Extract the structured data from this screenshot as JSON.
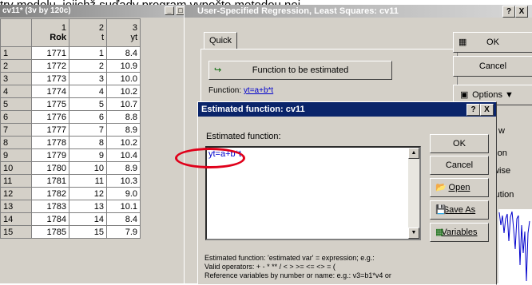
{
  "caption": "try modelu, jejichž suďady program vypočte metodou nej",
  "spreadsheet": {
    "title": "cv11* (3v by 120c)",
    "columns": [
      {
        "number": "1",
        "name": "Rok"
      },
      {
        "number": "2",
        "name": "t"
      },
      {
        "number": "3",
        "name": "yt"
      }
    ],
    "rows": [
      [
        "1",
        "1771",
        "1",
        "8.4"
      ],
      [
        "2",
        "1772",
        "2",
        "10.9"
      ],
      [
        "3",
        "1773",
        "3",
        "10.0"
      ],
      [
        "4",
        "1774",
        "4",
        "10.2"
      ],
      [
        "5",
        "1775",
        "5",
        "10.7"
      ],
      [
        "6",
        "1776",
        "6",
        "8.8"
      ],
      [
        "7",
        "1777",
        "7",
        "8.9"
      ],
      [
        "8",
        "1778",
        "8",
        "10.2"
      ],
      [
        "9",
        "1779",
        "9",
        "10.4"
      ],
      [
        "10",
        "1780",
        "10",
        "8.9"
      ],
      [
        "11",
        "1781",
        "11",
        "10.3"
      ],
      [
        "12",
        "1782",
        "12",
        "9.0"
      ],
      [
        "13",
        "1783",
        "13",
        "10.1"
      ],
      [
        "14",
        "1784",
        "14",
        "8.4"
      ],
      [
        "15",
        "1785",
        "15",
        "7.9"
      ]
    ]
  },
  "regression_dialog": {
    "title": "User-Specified Regression, Least Squares: cv11",
    "help": "?",
    "close": "X",
    "tab_quick": "Quick",
    "function_button": "Function to be estimated",
    "function_label": "Function:",
    "function_value": "yt=a+b*t",
    "ok": "OK",
    "cancel": "Cancel",
    "options": "Options",
    "partial": [
      "w",
      "ation",
      "ewise",
      "n",
      "titution"
    ]
  },
  "estimated_dialog": {
    "title": "Estimated function: cv11",
    "help": "?",
    "close": "X",
    "label": "Estimated function:",
    "value": "yt=a+b*t",
    "ok": "OK",
    "cancel": "Cancel",
    "open": "Open",
    "save_as": "Save As",
    "variables": "Variables",
    "help_line1": "Estimated function:   'estimated var' = expression;  e.g.:",
    "help_line2": "Valid operators:       +    -    *    **    /    <    >    >=    <=    <>    =    (",
    "help_line3": "Reference variables by number or name:   e.g.:  v3=b1*v4  or"
  }
}
